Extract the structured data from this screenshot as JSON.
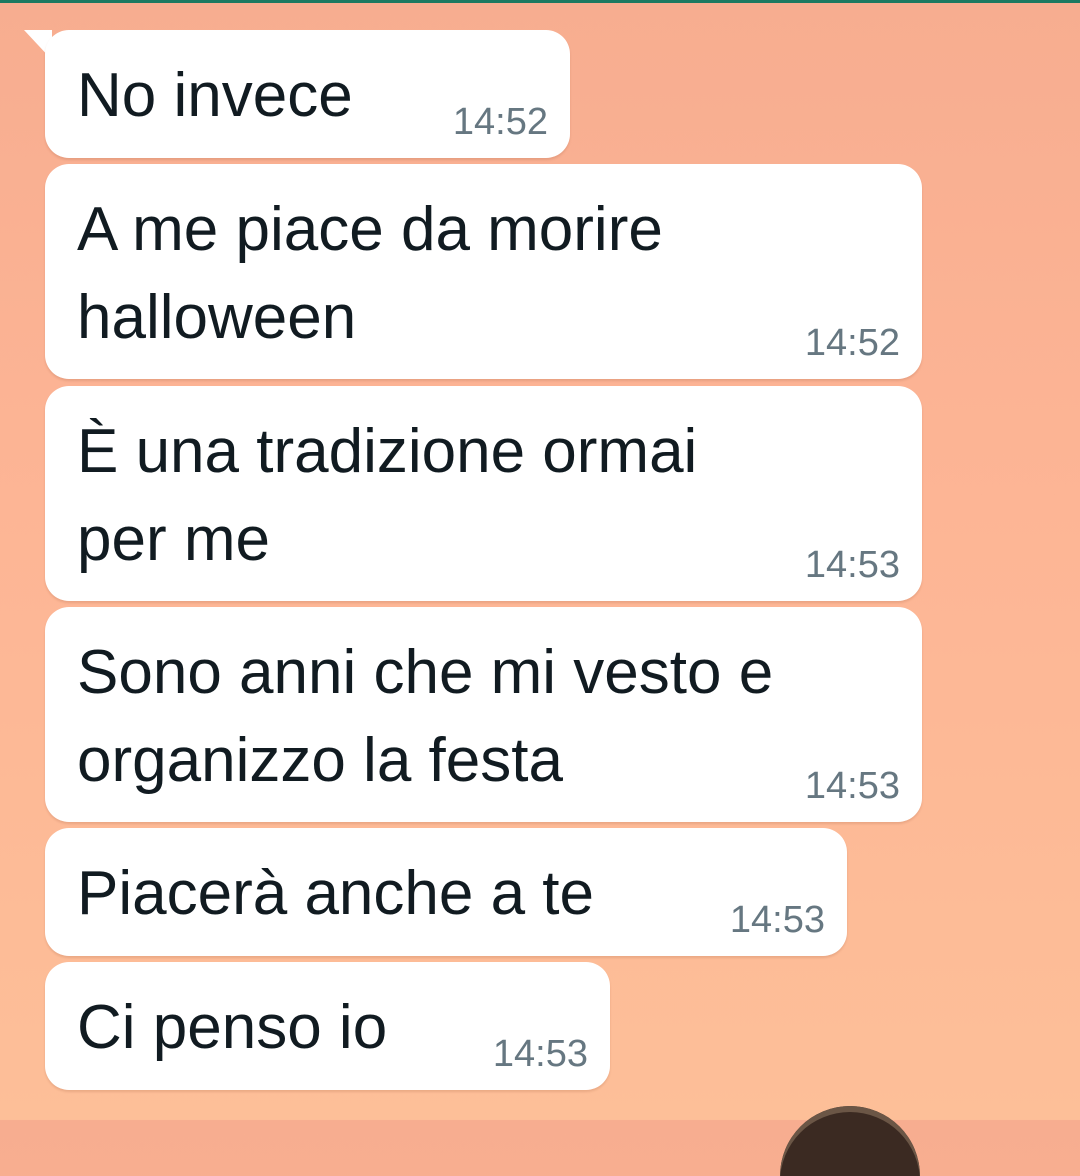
{
  "colors": {
    "background_top": "#f7ad90",
    "background_bottom": "#fdbf98",
    "bubble": "#ffffff",
    "message_text": "#111b21",
    "time_text": "#667781",
    "top_strip": "#1b7a62"
  },
  "messages": [
    {
      "text": "No invece",
      "time": "14:52"
    },
    {
      "text": "A me piace da morire\nhalloween",
      "time": "14:52"
    },
    {
      "text": "È una tradizione ormai\nper me",
      "time": "14:53"
    },
    {
      "text": "Sono anni che mi vesto e\norganizzo la festa",
      "time": "14:53"
    },
    {
      "text": "Piacerà anche a te",
      "time": "14:53"
    },
    {
      "text": "Ci penso io",
      "time": "14:53"
    }
  ]
}
